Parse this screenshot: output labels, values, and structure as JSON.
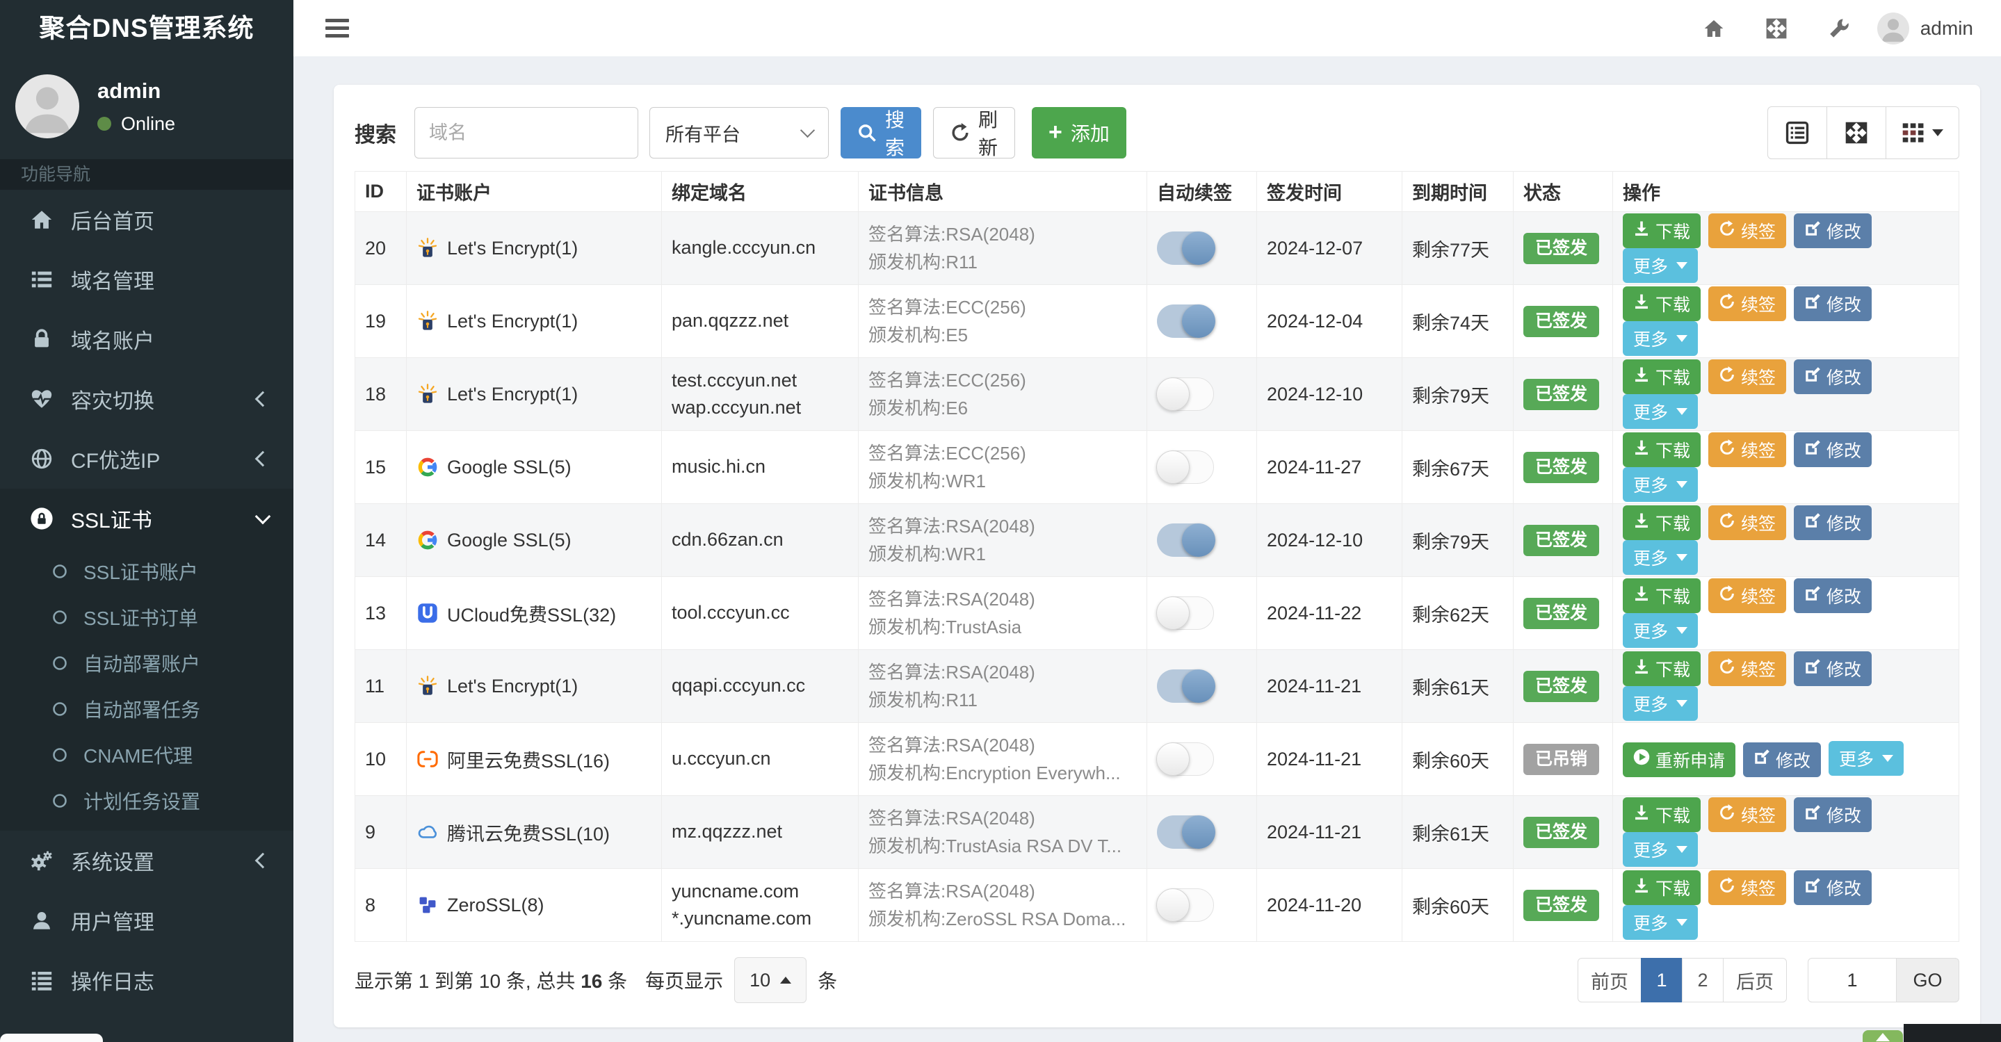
{
  "app_title": "聚合DNS管理系统",
  "colors": {
    "sidebar_bg": "#222d32",
    "sidebar_active_bg": "#1e282c",
    "primary_blue": "#4b8bcd",
    "add_green": "#4da64d",
    "renew_orange": "#e9a23c",
    "edit_blue": "#5b7fa9",
    "more_info_blue": "#5bc0de",
    "badge_green": "#57a957",
    "badge_gray": "#a2a2a2",
    "days_green": "#55a532",
    "active_page_blue": "#3d6fab",
    "online_dot_green": "#5e8c47"
  },
  "topbar": {
    "username": "admin"
  },
  "sidebar": {
    "user": {
      "name": "admin",
      "status": "Online"
    },
    "section_header": "功能导航",
    "items": [
      {
        "key": "home",
        "label": "后台首页",
        "icon": "home-icon"
      },
      {
        "key": "domains",
        "label": "域名管理",
        "icon": "list-icon"
      },
      {
        "key": "domain-accounts",
        "label": "域名账户",
        "icon": "lock-icon"
      },
      {
        "key": "failover",
        "label": "容灾切换",
        "icon": "heartbeat-icon",
        "chevron": "left"
      },
      {
        "key": "cf-ip",
        "label": "CF优选IP",
        "icon": "globe-icon",
        "chevron": "left"
      },
      {
        "key": "ssl",
        "label": "SSL证书",
        "icon": "ssl-icon",
        "chevron": "down",
        "active": true,
        "children": [
          {
            "key": "ssl-accounts",
            "label": "SSL证书账户"
          },
          {
            "key": "ssl-orders",
            "label": "SSL证书订单"
          },
          {
            "key": "deploy-accounts",
            "label": "自动部署账户"
          },
          {
            "key": "deploy-tasks",
            "label": "自动部署任务"
          },
          {
            "key": "cname-proxy",
            "label": "CNAME代理"
          },
          {
            "key": "cron-settings",
            "label": "计划任务设置"
          }
        ]
      },
      {
        "key": "system",
        "label": "系统设置",
        "icon": "gears-icon",
        "chevron": "left"
      },
      {
        "key": "users",
        "label": "用户管理",
        "icon": "user-icon"
      },
      {
        "key": "logs",
        "label": "操作日志",
        "icon": "log-icon"
      }
    ]
  },
  "toolbar": {
    "search_label": "搜索",
    "search_placeholder": "域名",
    "platform_select_value": "所有平台",
    "search_button": "搜索",
    "refresh_button": "刷新",
    "add_button": "添加"
  },
  "table": {
    "columns": [
      "ID",
      "证书账户",
      "绑定域名",
      "证书信息",
      "自动续签",
      "签发时间",
      "到期时间",
      "状态",
      "操作"
    ],
    "cert_info_labels": {
      "algo": "签名算法:",
      "issuer": "颁发机构:"
    },
    "actions": {
      "download": "下载",
      "renew": "续签",
      "edit": "修改",
      "more": "更多",
      "reapply": "重新申请"
    },
    "rows": [
      {
        "id": "20",
        "account": "Let's Encrypt(1)",
        "account_icon": "lets-encrypt-icon",
        "domains": [
          "kangle.cccyun.cn"
        ],
        "algo": "RSA(2048)",
        "issuer": "R11",
        "auto_renew": true,
        "issued": "2024-12-07",
        "expires": "剩余77天",
        "status": "已签发",
        "status_type": "success",
        "action_set": "normal"
      },
      {
        "id": "19",
        "account": "Let's Encrypt(1)",
        "account_icon": "lets-encrypt-icon",
        "domains": [
          "pan.qqzzz.net"
        ],
        "algo": "ECC(256)",
        "issuer": "E5",
        "auto_renew": true,
        "issued": "2024-12-04",
        "expires": "剩余74天",
        "status": "已签发",
        "status_type": "success",
        "action_set": "normal"
      },
      {
        "id": "18",
        "account": "Let's Encrypt(1)",
        "account_icon": "lets-encrypt-icon",
        "domains": [
          "test.cccyun.net",
          "wap.cccyun.net"
        ],
        "algo": "ECC(256)",
        "issuer": "E6",
        "auto_renew": false,
        "issued": "2024-12-10",
        "expires": "剩余79天",
        "status": "已签发",
        "status_type": "success",
        "action_set": "normal"
      },
      {
        "id": "15",
        "account": "Google SSL(5)",
        "account_icon": "google-icon",
        "domains": [
          "music.hi.cn"
        ],
        "algo": "ECC(256)",
        "issuer": "WR1",
        "auto_renew": false,
        "issued": "2024-11-27",
        "expires": "剩余67天",
        "status": "已签发",
        "status_type": "success",
        "action_set": "normal"
      },
      {
        "id": "14",
        "account": "Google SSL(5)",
        "account_icon": "google-icon",
        "domains": [
          "cdn.66zan.cn"
        ],
        "algo": "RSA(2048)",
        "issuer": "WR1",
        "auto_renew": true,
        "issued": "2024-12-10",
        "expires": "剩余79天",
        "status": "已签发",
        "status_type": "success",
        "action_set": "normal"
      },
      {
        "id": "13",
        "account": "UCloud免费SSL(32)",
        "account_icon": "ucloud-icon",
        "domains": [
          "tool.cccyun.cc"
        ],
        "algo": "RSA(2048)",
        "issuer": "TrustAsia",
        "auto_renew": false,
        "issued": "2024-11-22",
        "expires": "剩余62天",
        "status": "已签发",
        "status_type": "success",
        "action_set": "normal"
      },
      {
        "id": "11",
        "account": "Let's Encrypt(1)",
        "account_icon": "lets-encrypt-icon",
        "domains": [
          "qqapi.cccyun.cc"
        ],
        "algo": "RSA(2048)",
        "issuer": "R11",
        "auto_renew": true,
        "issued": "2024-11-21",
        "expires": "剩余61天",
        "status": "已签发",
        "status_type": "success",
        "action_set": "normal"
      },
      {
        "id": "10",
        "account": "阿里云免费SSL(16)",
        "account_icon": "aliyun-icon",
        "domains": [
          "u.cccyun.cn"
        ],
        "algo": "RSA(2048)",
        "issuer": "Encryption Everywh...",
        "auto_renew": false,
        "issued": "2024-11-21",
        "expires": "剩余60天",
        "status": "已吊销",
        "status_type": "gray",
        "action_set": "revoked"
      },
      {
        "id": "9",
        "account": "腾讯云免费SSL(10)",
        "account_icon": "tencent-icon",
        "domains": [
          "mz.qqzzz.net"
        ],
        "algo": "RSA(2048)",
        "issuer": "TrustAsia RSA DV T...",
        "auto_renew": true,
        "issued": "2024-11-21",
        "expires": "剩余61天",
        "status": "已签发",
        "status_type": "success",
        "action_set": "normal"
      },
      {
        "id": "8",
        "account": "ZeroSSL(8)",
        "account_icon": "zerossl-icon",
        "domains": [
          "yuncname.com",
          "*.yuncname.com"
        ],
        "algo": "RSA(2048)",
        "issuer": "ZeroSSL RSA Doma...",
        "auto_renew": false,
        "issued": "2024-11-20",
        "expires": "剩余60天",
        "status": "已签发",
        "status_type": "success",
        "action_set": "normal"
      }
    ]
  },
  "pagination": {
    "summary_prefix": "显示第 1 到第 10 条, 总共 ",
    "summary_total": "16",
    "summary_suffix": " 条",
    "per_page_label": "每页显示",
    "per_page_value": "10",
    "per_page_unit": "条",
    "prev": "前页",
    "next": "后页",
    "pages": [
      "1",
      "2"
    ],
    "active_page": "1",
    "goto_value": "1",
    "go_button": "GO"
  }
}
